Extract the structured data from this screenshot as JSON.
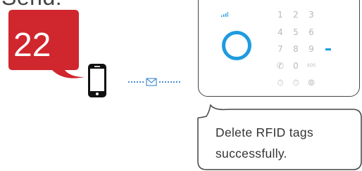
{
  "instruction": {
    "heading": "Send:"
  },
  "step": {
    "number": "22",
    "bubble_color": "#d0262d"
  },
  "panel": {
    "keys": [
      "1",
      "2",
      "3",
      "4",
      "5",
      "6",
      "7",
      "8",
      "9",
      "✆",
      "0",
      "SOS",
      "⏱",
      "⏱",
      "⦾"
    ],
    "ring_color": "#1e9be0"
  },
  "response": {
    "line1": "Delete RFID tags",
    "line2": "successfully."
  }
}
